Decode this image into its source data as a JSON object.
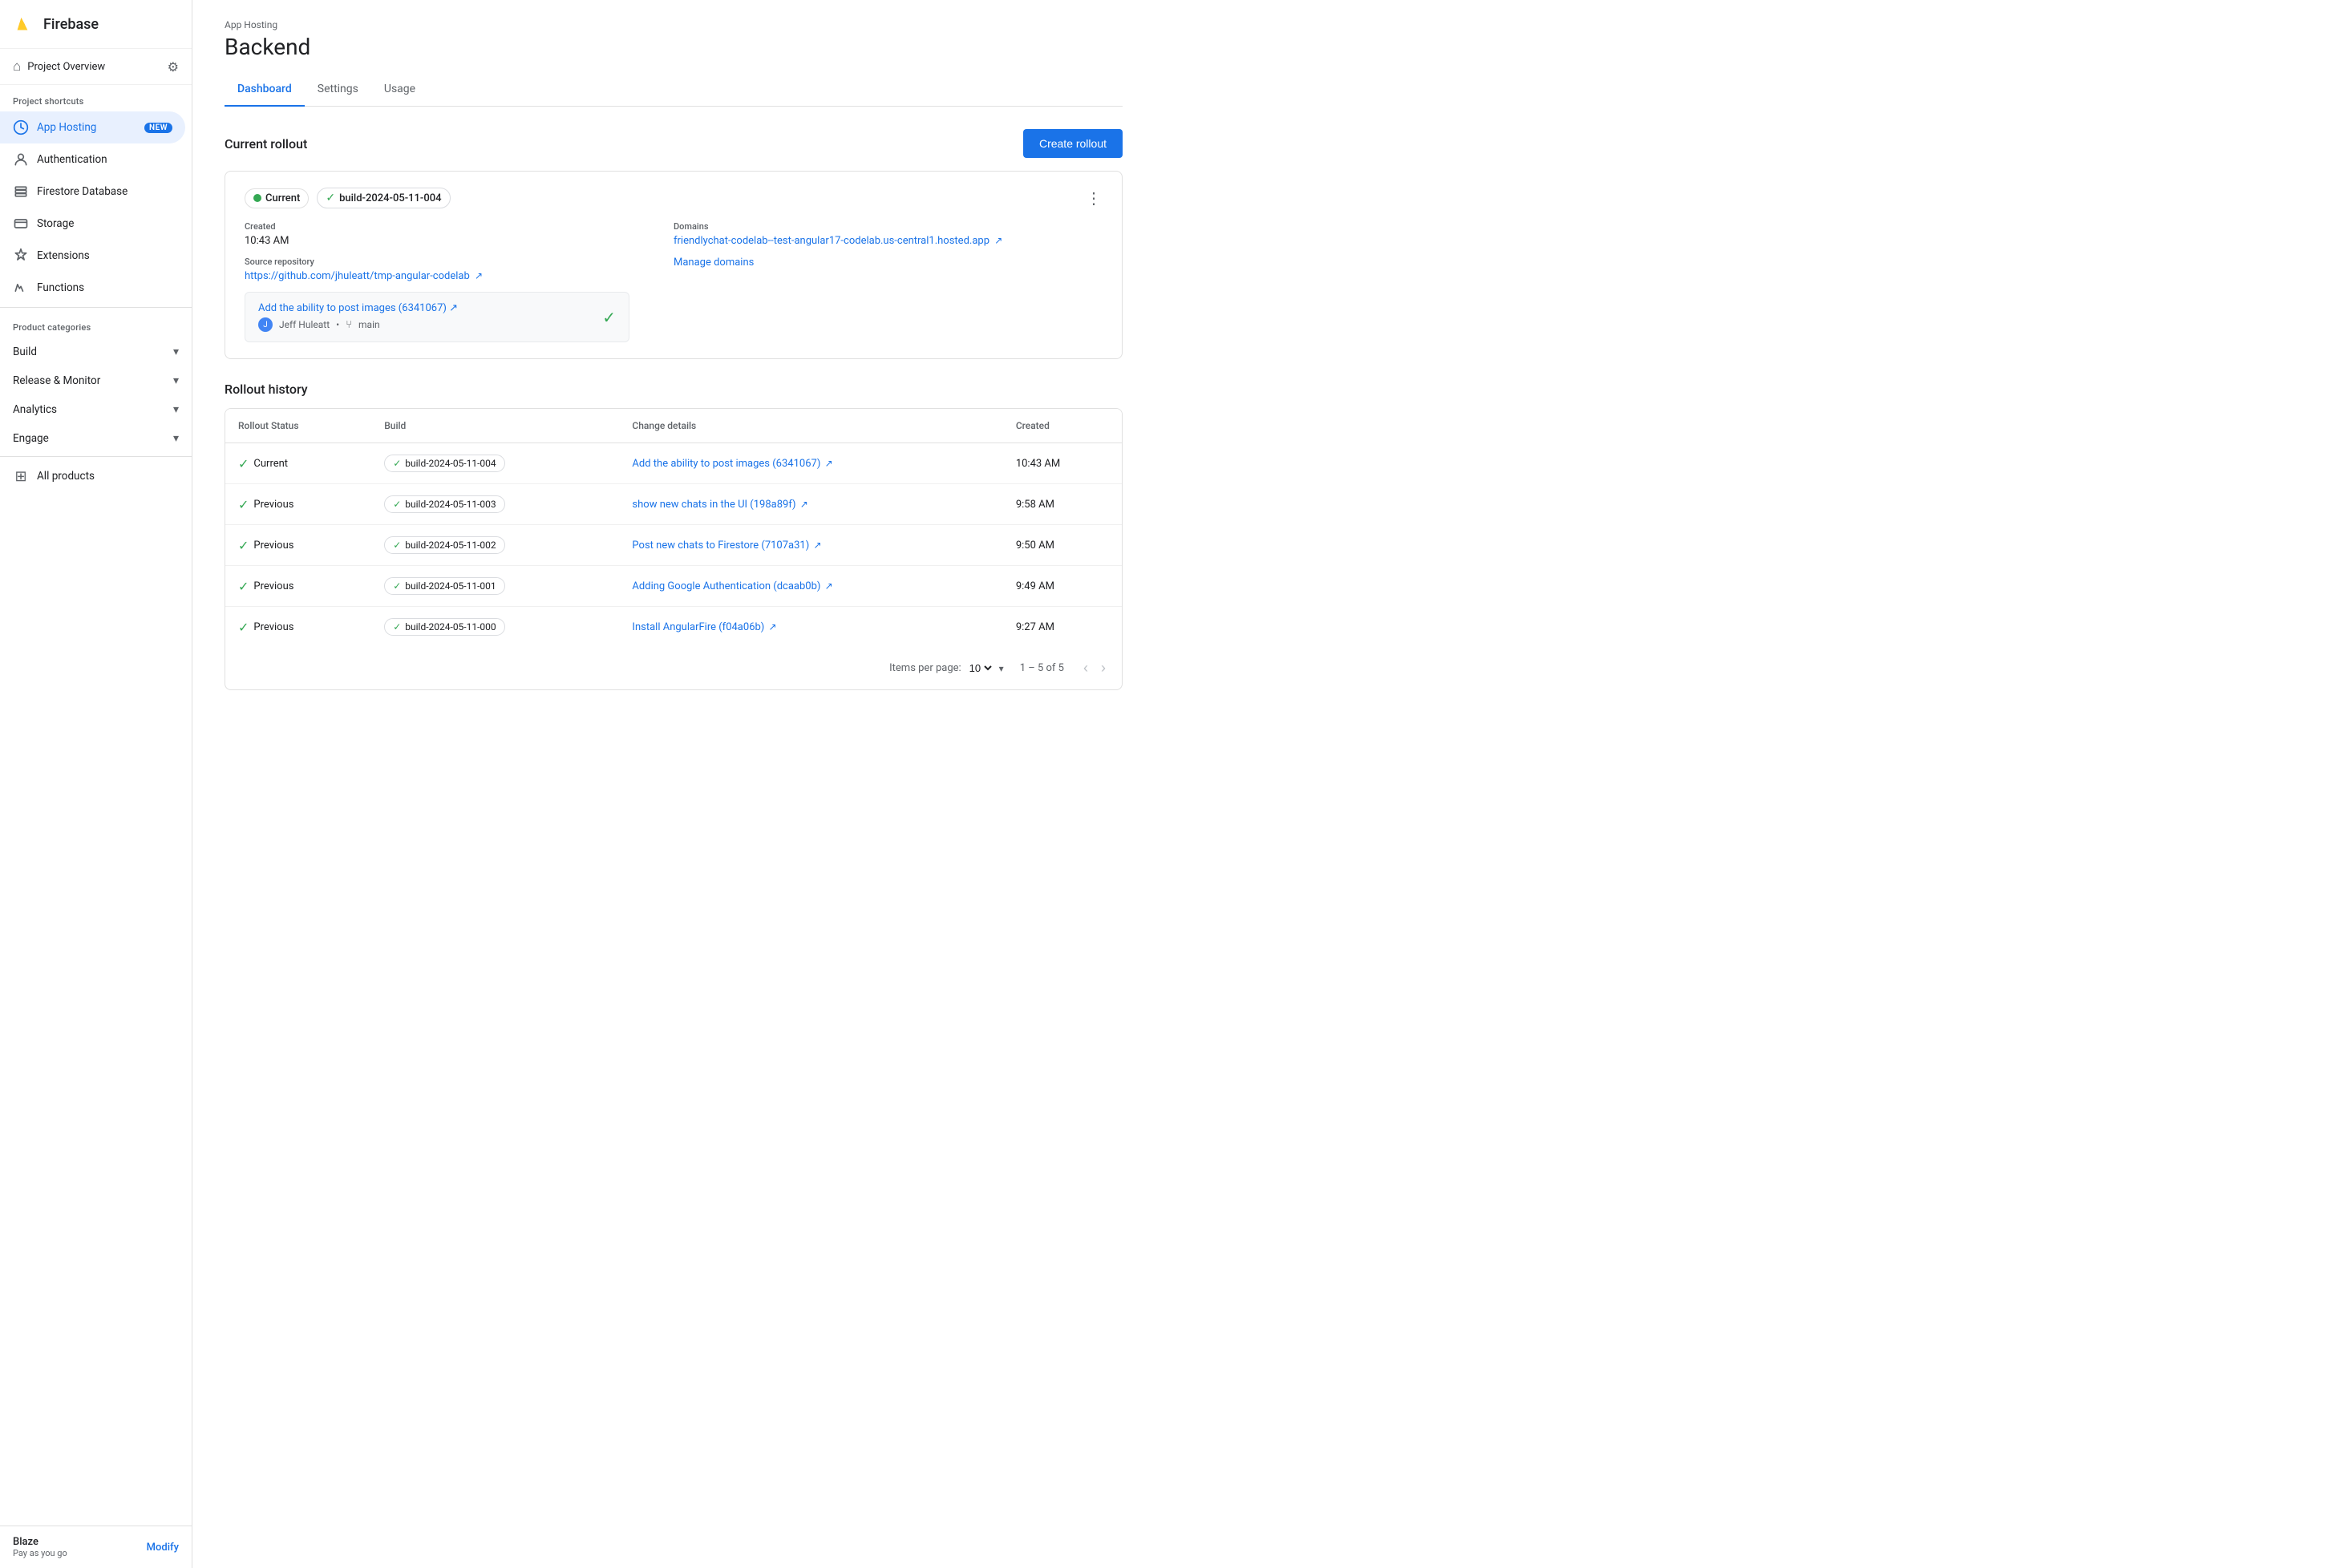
{
  "app": {
    "title": "Firebase"
  },
  "sidebar": {
    "project_overview": "Project Overview",
    "project_shortcuts_label": "Project shortcuts",
    "product_categories_label": "Product categories",
    "nav_items_shortcuts": [
      {
        "id": "app-hosting",
        "label": "App Hosting",
        "badge": "NEW",
        "active": true,
        "icon": "hosting"
      },
      {
        "id": "authentication",
        "label": "Authentication",
        "icon": "auth"
      },
      {
        "id": "firestore",
        "label": "Firestore Database",
        "icon": "firestore"
      },
      {
        "id": "storage",
        "label": "Storage",
        "icon": "storage"
      },
      {
        "id": "extensions",
        "label": "Extensions",
        "icon": "extensions"
      },
      {
        "id": "functions",
        "label": "Functions",
        "icon": "functions"
      }
    ],
    "nav_items_categories": [
      {
        "id": "build",
        "label": "Build",
        "expandable": true
      },
      {
        "id": "release-monitor",
        "label": "Release & Monitor",
        "expandable": true
      },
      {
        "id": "analytics",
        "label": "Analytics",
        "expandable": true
      },
      {
        "id": "engage",
        "label": "Engage",
        "expandable": true
      }
    ],
    "all_products": "All products",
    "footer": {
      "plan": "Blaze",
      "sub": "Pay as you go",
      "modify_label": "Modify"
    }
  },
  "header": {
    "breadcrumb": "App Hosting",
    "title": "Backend"
  },
  "tabs": [
    {
      "id": "dashboard",
      "label": "Dashboard",
      "active": true
    },
    {
      "id": "settings",
      "label": "Settings"
    },
    {
      "id": "usage",
      "label": "Usage"
    }
  ],
  "current_rollout": {
    "section_title": "Current rollout",
    "create_rollout_label": "Create rollout",
    "status_label": "Current",
    "build_label": "build-2024-05-11-004",
    "created_label": "Created",
    "created_value": "10:43 AM",
    "source_repo_label": "Source repository",
    "source_repo_link": "https://github.com/jhuleatt/tmp-angular-codelab",
    "domains_label": "Domains",
    "domains_link": "friendlychat-codelab--test-angular17-codelab.us-central1.hosted.app",
    "commit_title": "Add the ability to post images (6341067)",
    "commit_title_short": "Add the ability to post images (6341067) ↗",
    "commit_author": "Jeff Huleatt",
    "commit_branch": "main",
    "manage_domains": "Manage domains"
  },
  "rollout_history": {
    "section_title": "Rollout history",
    "columns": [
      "Rollout Status",
      "Build",
      "Change details",
      "Created"
    ],
    "rows": [
      {
        "status": "Current",
        "build": "build-2024-05-11-004",
        "change": "Add the ability to post images (6341067)",
        "created": "10:43 AM"
      },
      {
        "status": "Previous",
        "build": "build-2024-05-11-003",
        "change": "show new chats in the UI (198a89f)",
        "created": "9:58 AM"
      },
      {
        "status": "Previous",
        "build": "build-2024-05-11-002",
        "change": "Post new chats to Firestore (7107a31)",
        "created": "9:50 AM"
      },
      {
        "status": "Previous",
        "build": "build-2024-05-11-001",
        "change": "Adding Google Authentication (dcaab0b)",
        "created": "9:49 AM"
      },
      {
        "status": "Previous",
        "build": "build-2024-05-11-000",
        "change": "Install AngularFire (f04a06b)",
        "created": "9:27 AM"
      }
    ],
    "pagination": {
      "items_per_page_label": "Items per page:",
      "items_per_page_value": "10",
      "range": "1 – 5 of 5"
    }
  }
}
